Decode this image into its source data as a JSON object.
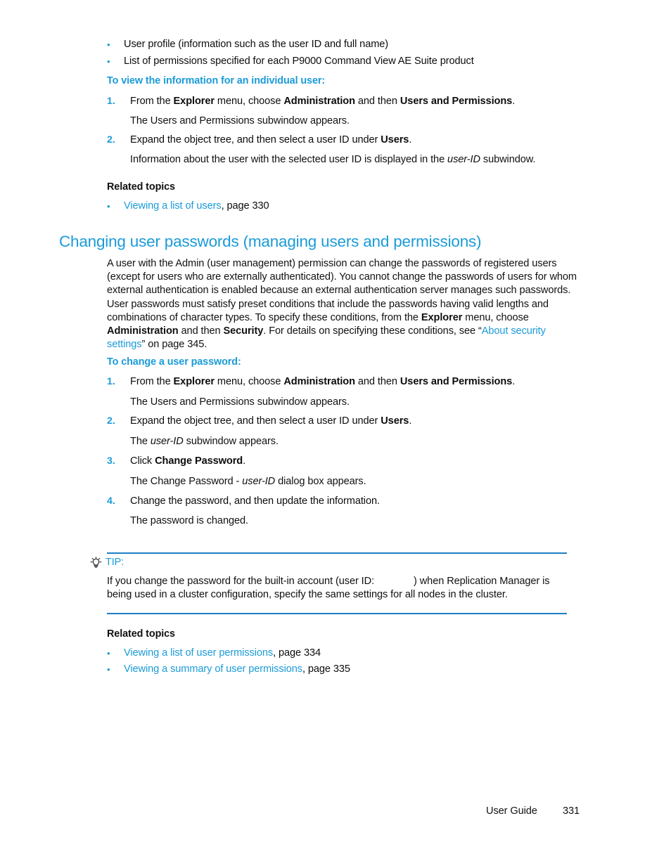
{
  "intro_bullets": [
    {
      "marker": "•",
      "text": "User profile (information such as the user ID and full name)"
    },
    {
      "marker": "•",
      "text": "List of permissions specified for each P9000 Command View AE Suite product"
    }
  ],
  "procedure_one": {
    "heading": "To view the information for an individual user:",
    "steps": [
      {
        "num": "1.",
        "lead": "From the ",
        "bold1": "Explorer",
        "mid1": " menu, choose ",
        "bold2": "Administration",
        "mid2": " and then ",
        "bold3": "Users and Permissions",
        "tail": ".",
        "result": "The Users and Permissions subwindow appears."
      },
      {
        "num": "2.",
        "lead": "Expand the object tree, and then select a user ID under ",
        "bold1": "Users",
        "tail": ".",
        "result_pre": "Information about the user with the selected user ID is displayed in the ",
        "result_italic": "user-ID",
        "result_post": " subwindow."
      }
    ]
  },
  "related_topics_one": {
    "heading": "Related topics",
    "items": [
      {
        "marker": "•",
        "link": "Viewing a list of users",
        "suffix": ", page 330"
      }
    ]
  },
  "section": {
    "title": "Changing user passwords (managing users and permissions)",
    "paragraph": {
      "part1": "A user with the Admin (user management) permission can change the passwords of registered users (except for users who are externally authenticated). You cannot change the passwords of users for whom external authentication is enabled because an external authentication server manages such passwords. User passwords must satisfy preset conditions that include the passwords having valid lengths and combinations of character types. To specify these conditions, from the ",
      "bold1": "Explorer",
      "part2": " menu, choose ",
      "bold2": "Administration",
      "part3": " and then ",
      "bold3": "Security",
      "part4": ". For details on specifying these conditions, see “",
      "link1": "About security settings",
      "part5": "” on page 345."
    }
  },
  "procedure_two": {
    "heading": "To change a user password:",
    "steps": [
      {
        "num": "1.",
        "lead": "From the ",
        "bold1": "Explorer",
        "mid1": " menu, choose ",
        "bold2": "Administration",
        "mid2": " and then ",
        "bold3": "Users and Permissions",
        "tail": ".",
        "result": "The Users and Permissions subwindow appears."
      },
      {
        "num": "2.",
        "lead": "Expand the object tree, and then select a user ID under ",
        "bold1": "Users",
        "tail": ".",
        "result_pre": "The ",
        "result_italic": "user-ID",
        "result_post": " subwindow appears."
      },
      {
        "num": "3.",
        "lead": "Click ",
        "bold1": "Change Password",
        "tail": ".",
        "result_pre": "The Change Password - ",
        "result_italic": "user-ID",
        "result_post": " dialog box appears."
      },
      {
        "num": "4.",
        "lead": "Change the password, and then update the information.",
        "result": "The password is changed."
      }
    ]
  },
  "tip": {
    "icon": "lightbulb-icon",
    "label": "TIP:",
    "text_before_blank": "If you change the password for the built-in account (user ID:",
    "text_after_blank": ") when Replication Manager is being used in a cluster configuration, specify the same settings for all nodes in the cluster."
  },
  "related_topics_two": {
    "heading": "Related topics",
    "items": [
      {
        "marker": "•",
        "link": "Viewing a list of user permissions",
        "suffix": ", page 334"
      },
      {
        "marker": "•",
        "link": "Viewing a summary of user permissions",
        "suffix": ", page 335"
      }
    ]
  },
  "footer": {
    "guide_label": "User Guide",
    "page_number": "331"
  },
  "colors": {
    "accent_blue": "#1B9BD8",
    "rule_blue": "#1B7FC4",
    "body_text": "#111111"
  }
}
